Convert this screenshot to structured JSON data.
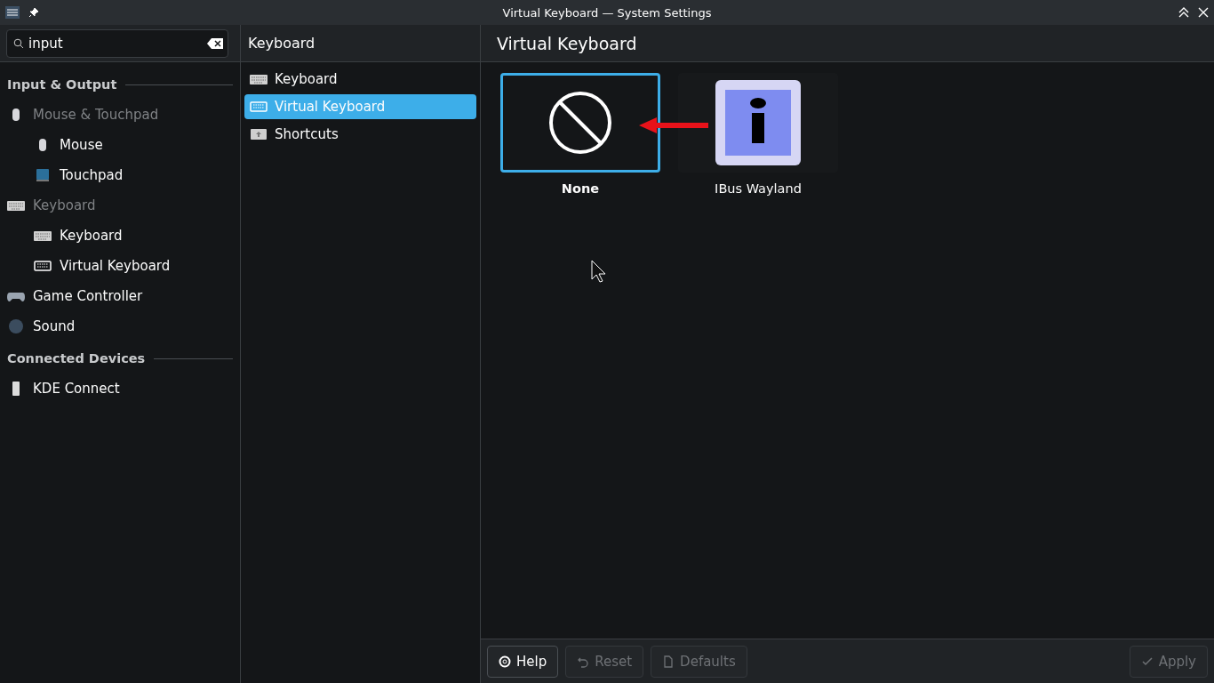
{
  "window": {
    "title": "Virtual Keyboard — System Settings"
  },
  "search": {
    "value": "input"
  },
  "sidebar": {
    "sections": [
      {
        "title": "Input & Output",
        "items": [
          {
            "label": "Mouse & Touchpad",
            "kind": "mouse",
            "disabled": true,
            "children": [
              {
                "label": "Mouse",
                "kind": "mouse",
                "disabled": false
              },
              {
                "label": "Touchpad",
                "kind": "touchpad",
                "disabled": false
              }
            ]
          },
          {
            "label": "Keyboard",
            "kind": "keyboard",
            "disabled": true,
            "children": [
              {
                "label": "Keyboard",
                "kind": "keyboard",
                "disabled": false
              },
              {
                "label": "Virtual Keyboard",
                "kind": "vkeyboard",
                "disabled": false
              }
            ]
          },
          {
            "label": "Game Controller",
            "kind": "gamepad",
            "disabled": false
          },
          {
            "label": "Sound",
            "kind": "sound",
            "disabled": false
          }
        ]
      },
      {
        "title": "Connected Devices",
        "items": [
          {
            "label": "KDE Connect",
            "kind": "phone",
            "disabled": false
          }
        ]
      }
    ]
  },
  "subpanel": {
    "title": "Keyboard",
    "items": [
      {
        "label": "Keyboard",
        "kind": "keyboard",
        "selected": false
      },
      {
        "label": "Virtual Keyboard",
        "kind": "vkeyboard",
        "selected": true
      },
      {
        "label": "Shortcuts",
        "kind": "shortcut",
        "selected": false
      }
    ]
  },
  "page": {
    "title": "Virtual Keyboard",
    "options": [
      {
        "label": "None",
        "kind": "none",
        "selected": true
      },
      {
        "label": "IBus Wayland",
        "kind": "ibus",
        "selected": false
      }
    ]
  },
  "buttons": [
    {
      "label": "Help",
      "kind": "help",
      "disabled": false
    },
    {
      "label": "Reset",
      "kind": "reset",
      "disabled": true
    },
    {
      "label": "Defaults",
      "kind": "defaults",
      "disabled": true
    },
    {
      "label": "Apply",
      "kind": "apply",
      "disabled": true
    }
  ]
}
